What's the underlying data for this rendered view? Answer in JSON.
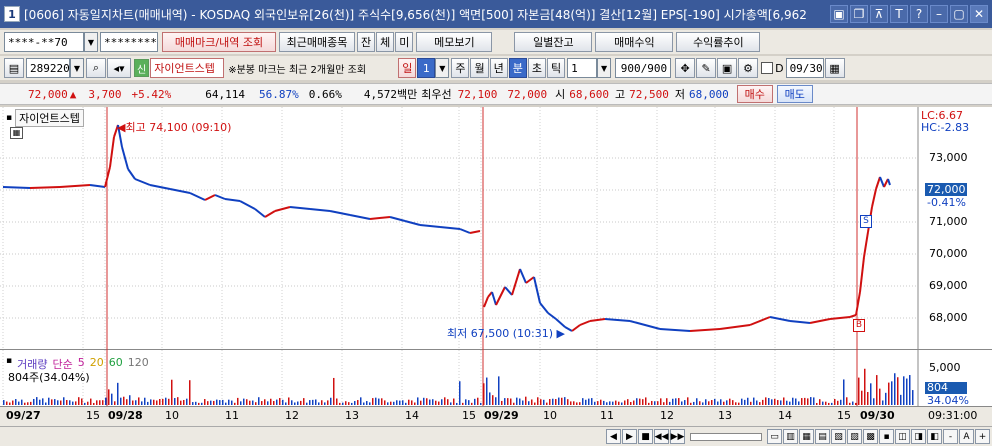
{
  "title": {
    "window_number": "1",
    "text": "[0606] 자동일지차트(매매내역) - KOSDAQ 외국인보유[26(천)] 주식수[9,656(천)] 액면[500] 자본금[48(억)] 결산[12월] EPS[-190] 시가총액[6,962"
  },
  "row1": {
    "account": "****-**70",
    "password": "********",
    "btn_trade_mark": "매매마크/내역 조회",
    "btn_recent": "최근매매종목",
    "btn_jan": "잔",
    "btn_che": "체",
    "btn_mi": "미",
    "btn_memo": "메모보기",
    "btn_daily": "일별잔고",
    "btn_profit": "매매수익",
    "btn_return": "수익률추이"
  },
  "row2": {
    "code": "289220",
    "sin": "신",
    "stock_name": "자이언트스텝",
    "note": "※분봉 마크는 최근 2개월만 조회",
    "period_il": "일",
    "period_num": "1",
    "p_ju": "주",
    "p_wol": "월",
    "p_nyeon": "년",
    "p_bun": "분",
    "p_cho": "초",
    "p_tik": "틱",
    "interval": "1",
    "count": "900/900",
    "d_label": "D",
    "date": "09/30"
  },
  "quote": {
    "price": "72,000",
    "up_arrow": "▲",
    "change": "3,700",
    "change_pct": "+5.42%",
    "volume": "64,114",
    "vol_ratio": "56.87%",
    "turnover": "0.66%",
    "amount": "4,572백만",
    "best_label": "최우선",
    "best_ask": "72,100",
    "best_bid": "72,000",
    "open_label": "시",
    "open": "68,600",
    "high_label": "고",
    "high": "72,500",
    "low_label": "저",
    "low": "68,000",
    "buy": "매수",
    "sell": "매도"
  },
  "chart": {
    "legend_name": "자이언트스텝",
    "high_annot": "최고 74,100 (09:10)",
    "low_annot": "최저 67,500 (10:31)",
    "lc": "LC:6.67",
    "hc": "HC:-2.83",
    "current_price": "72,000",
    "current_pct": "-0.41%",
    "price_ticks": [
      "73,000",
      "72,000",
      "71,000",
      "70,000",
      "69,000",
      "68,000"
    ],
    "vol_legend": {
      "name": "거래량",
      "simple": "단순",
      "ma5": "5",
      "ma20": "20",
      "ma60": "60",
      "ma120": "120",
      "sub": "804주(34.04%)"
    },
    "vol_ticks": [
      "5,000",
      "804",
      "34.04%"
    ],
    "x_labels": [
      "09/27",
      "15",
      "09/28",
      "10",
      "11",
      "12",
      "13",
      "14",
      "15",
      "09/29",
      "10",
      "11",
      "12",
      "13",
      "14",
      "15",
      "09/30"
    ],
    "time": "09:31:00",
    "mark_s": "S",
    "mark_b": "B"
  },
  "colors": {
    "up": "#d01010",
    "down": "#1040c0",
    "titlebar": "#3a5a9a"
  },
  "bottombar": {
    "minus": "-",
    "plus": "+",
    "a_label": "A"
  }
}
